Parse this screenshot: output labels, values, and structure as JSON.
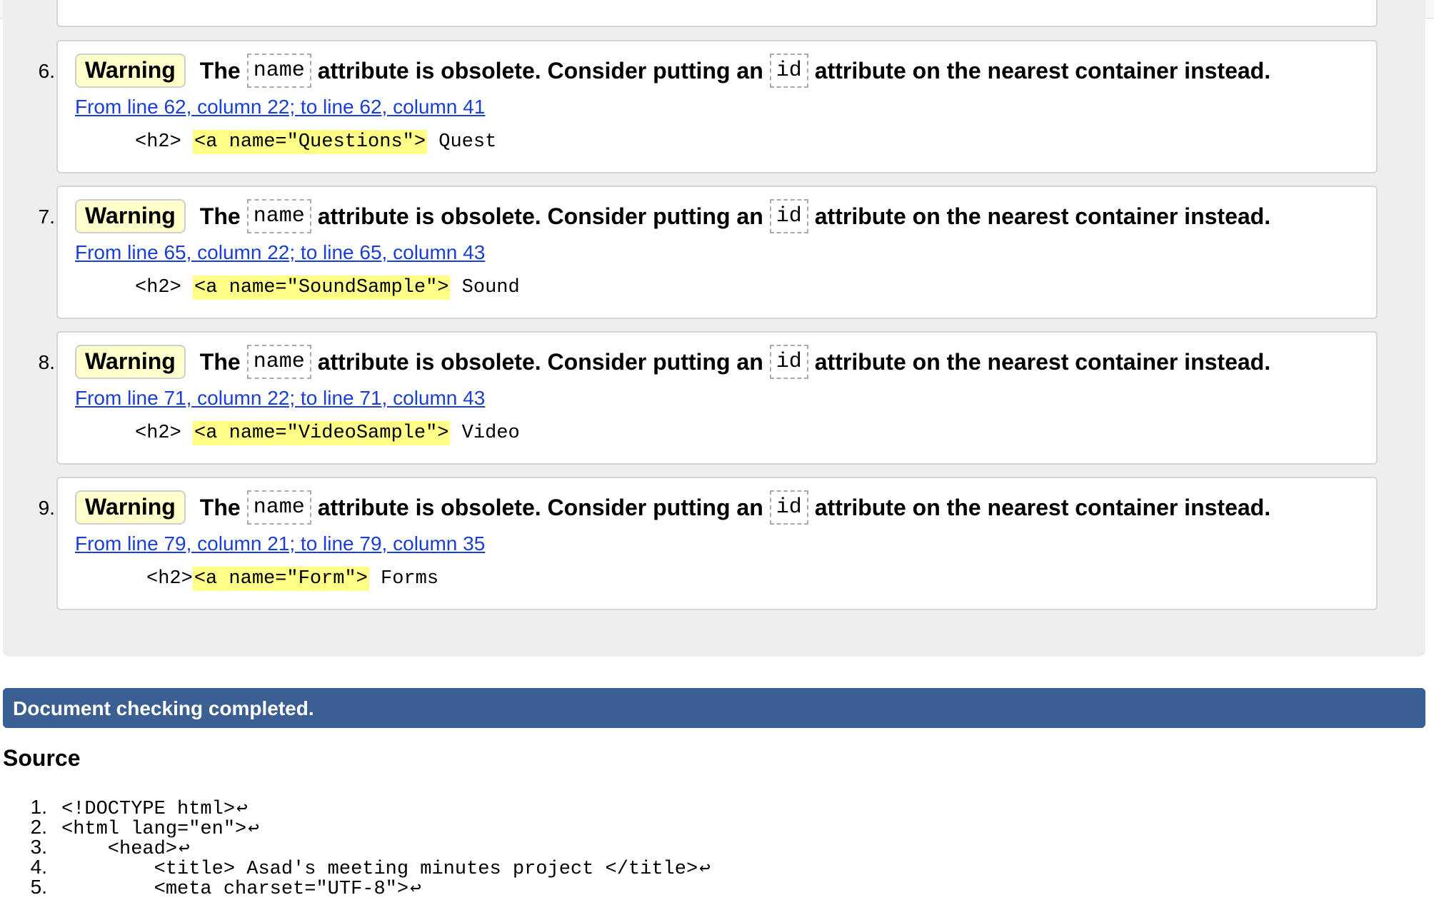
{
  "messages": [
    {
      "number": "6.",
      "badge": "Warning",
      "text_the": "The",
      "token_1": "name",
      "text_mid": "attribute is obsolete. Consider putting an",
      "token_2": "id",
      "text_end": "attribute on the nearest container instead.",
      "location": "From line 62, column 22; to line 62, column 41",
      "extract_pre": "<h2> ",
      "extract_highlight": "<a name=\"Questions\">",
      "extract_post": " Quest"
    },
    {
      "number": "7.",
      "badge": "Warning",
      "text_the": "The",
      "token_1": "name",
      "text_mid": "attribute is obsolete. Consider putting an",
      "token_2": "id",
      "text_end": "attribute on the nearest container instead.",
      "location": "From line 65, column 22; to line 65, column 43",
      "extract_pre": "<h2> ",
      "extract_highlight": "<a name=\"SoundSample\">",
      "extract_post": " Sound"
    },
    {
      "number": "8.",
      "badge": "Warning",
      "text_the": "The",
      "token_1": "name",
      "text_mid": "attribute is obsolete. Consider putting an",
      "token_2": "id",
      "text_end": "attribute on the nearest container instead.",
      "location": "From line 71, column 22; to line 71, column 43",
      "extract_pre": "<h2> ",
      "extract_highlight": "<a name=\"VideoSample\">",
      "extract_post": " Video"
    },
    {
      "number": "9.",
      "badge": "Warning",
      "text_the": "The",
      "token_1": "name",
      "text_mid": "attribute is obsolete. Consider putting an",
      "token_2": "id",
      "text_end": "attribute on the nearest container instead.",
      "location": "From line 79, column 21; to line 79, column 35",
      "extract_pre": "<h2>",
      "extract_highlight": "<a name=\"Form\">",
      "extract_post": " Forms"
    }
  ],
  "status": {
    "completed": "Document checking completed."
  },
  "source": {
    "heading": "Source",
    "return_glyph": "↩",
    "lines": [
      {
        "num": "1.",
        "code": "<!DOCTYPE html>"
      },
      {
        "num": "2.",
        "code": "<html lang=\"en\">"
      },
      {
        "num": "3.",
        "code": "    <head>"
      },
      {
        "num": "4.",
        "code": "        <title> Asad's meeting minutes project </title>"
      },
      {
        "num": "5.",
        "code": "        <meta charset=\"UTF-8\">"
      }
    ]
  },
  "colors": {
    "link": "#1a3fd6",
    "badge_bg": "#ffffcc",
    "highlight": "#ffff88",
    "status_bar": "#3b5e93",
    "panel_bg": "#eeeeee"
  }
}
